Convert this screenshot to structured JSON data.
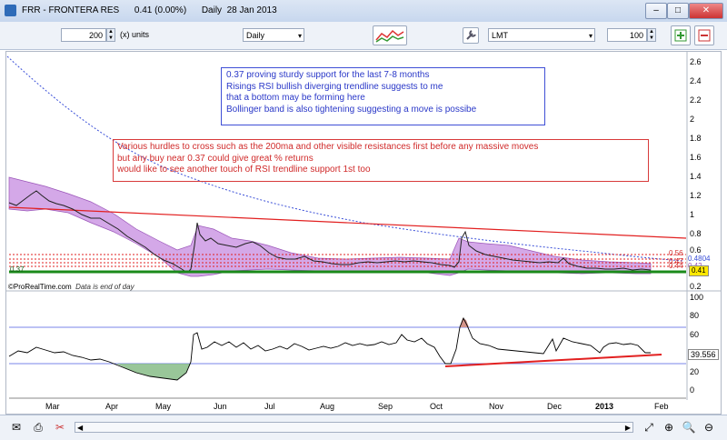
{
  "window": {
    "title": "FRR - FRONTERA RES      0.41 (0.00%)      Daily  28 Jan 2013",
    "minimize": "–",
    "maximize": "□",
    "close": "✕"
  },
  "toolbar": {
    "units_value": "200",
    "units_label": "(x) units",
    "period": "Daily",
    "indicator_select": "LMT",
    "qty_value": "100"
  },
  "annotations": {
    "blue": "0.37 proving sturdy support for the last 7-8 months\nRisings RSI bullish diverging trendline suggests to me\nthat a bottom may be forming here\nBollinger band is also tightening suggesting a move is possibe",
    "red": "Various hurdles to cross such as the 200ma and other visible resistances first before any massive moves\nbut any buy near 0.37 could give great % returns\nwould like to see another touch of RSI trendline support 1st too"
  },
  "price_axis": [
    "2.6",
    "2.4",
    "2.2",
    "2",
    "1.8",
    "1.6",
    "1.4",
    "1.2",
    "1",
    "0.8",
    "0.6",
    "0.4",
    "0.2"
  ],
  "price_tags": {
    "t1": "0.56",
    "t2": "0.47",
    "t3": "0.4804",
    "t4": "0.44",
    "t5": "0.42",
    "current": "0.41",
    "support": "0.37"
  },
  "rsi_axis": [
    "100",
    "80",
    "60",
    "40",
    "20",
    "0"
  ],
  "rsi_value": "39.556",
  "months": [
    "Mar",
    "Apr",
    "May",
    "Jun",
    "Jul",
    "Aug",
    "Sep",
    "Oct",
    "Nov",
    "Dec",
    "2013",
    "Feb"
  ],
  "footer": {
    "source": "©ProRealTime.com",
    "note": "Data is end of day"
  },
  "colors": {
    "band_fill": "#c58be0",
    "support": "#1a8a1a",
    "rsi_line": "#000000",
    "trend_red": "#e22020",
    "ma_blue": "#3a4fd8"
  }
}
